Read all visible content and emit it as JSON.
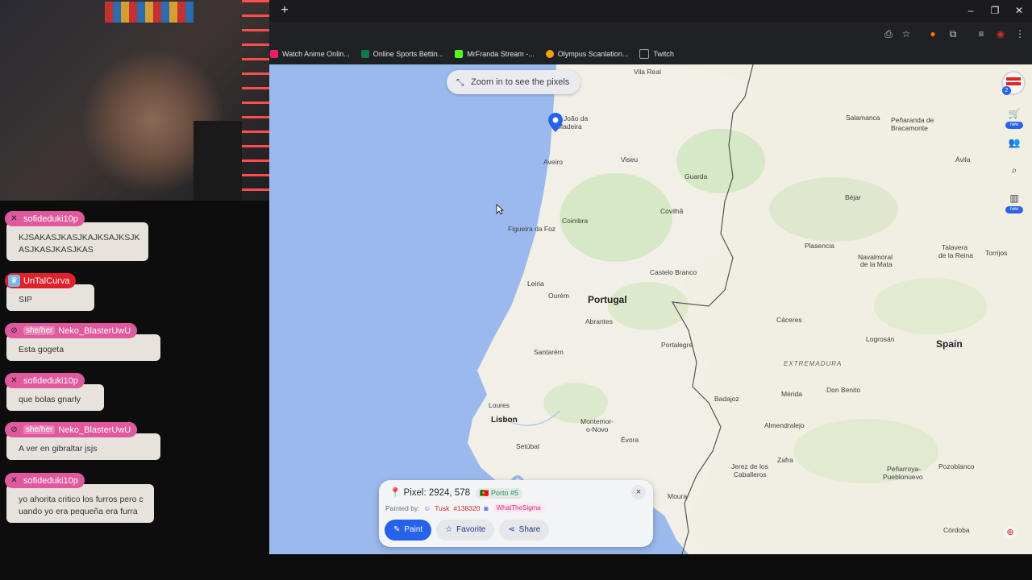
{
  "browser": {
    "bookmarks": [
      {
        "label": "Watch Anime Onlin...",
        "color": "#e91e63"
      },
      {
        "label": "Online Sports Bettin...",
        "color": "#0e7a4a"
      },
      {
        "label": "MrFranda Stream -...",
        "color": "#53fc18"
      },
      {
        "label": "Olympus Scanlation...",
        "color": "#f59e0b"
      },
      {
        "label": "Twitch",
        "color": "#9aa0a6"
      }
    ]
  },
  "map": {
    "zoom_hint": "Zoom in to see the pixels",
    "labels": {
      "vila_real": "Vila Real",
      "joao_madeira_1": "João da",
      "joao_madeira_2": "Madeira",
      "salamanca": "Salamanca",
      "penaranda_1": "Peñaranda de",
      "penaranda_2": "Bracamonte",
      "aveiro": "Aveiro",
      "viseu": "Viseu",
      "guarda": "Guarda",
      "avila": "Ávila",
      "bejar": "Béjar",
      "coimbra": "Coimbra",
      "covilha": "Covilhã",
      "figueira": "Figueira da Foz",
      "plasencia": "Plasencia",
      "navalmoral_1": "Navalmoral",
      "navalmoral_2": "de la Mata",
      "talavera_1": "Talavera",
      "talavera_2": "de la Reina",
      "torrijos": "Torrijos",
      "castelo_branco": "Castelo Branco",
      "leiria": "Leiria",
      "ourem": "Ourém",
      "portugal": "Portugal",
      "abrantes": "Abrantes",
      "caceres": "Cáceres",
      "santarem": "Santarém",
      "portalegre": "Portalegre",
      "logrosan": "Logrosán",
      "spain": "Spain",
      "extremadura": "EXTREMADURA",
      "merida": "Mérida",
      "don_benito": "Don Benito",
      "badajoz": "Badajoz",
      "loures": "Loures",
      "lisbon": "Lisbon",
      "montemor_1": "Montemor-",
      "montemor_2": "o-Novo",
      "evora": "Évora",
      "almendralejo": "Almendralejo",
      "setubal": "Setúbal",
      "zafra": "Zafra",
      "jerez_1": "Jerez de los",
      "jerez_2": "Caballeros",
      "penarroya_1": "Peñarroya-",
      "penarroya_2": "Pueblonuevo",
      "pozoblanco": "Pozoblanco",
      "moura": "Moura",
      "cordoba": "Córdoba"
    }
  },
  "sidebar_tools": {
    "new_badge_1": "new",
    "new_badge_2": "new",
    "notif_count": "2"
  },
  "pixel_panel": {
    "title": "Pixel: 2924, 578",
    "region": "Porto #5",
    "painted_by_label": "Painted by:",
    "painter": "Tusk",
    "painter_id": "#138320",
    "alliance": "WhatTheSigma",
    "paint_label": "Paint",
    "favorite_label": "Favorite",
    "share_label": "Share",
    "close_icon": "×"
  },
  "chat": {
    "messages": [
      {
        "user": "sofideduki10p",
        "color": "#e0589d",
        "pronoun": "",
        "text": "KJSAKASJKASJKAJKSAJKSJKASJKASJKASJKAS"
      },
      {
        "user": "UnTalCurva",
        "color": "#e0212c",
        "pronoun": "",
        "text": "SIP"
      },
      {
        "user": "Neko_BlasterUwU",
        "color": "#e0589d",
        "pronoun": "she/her",
        "text": "Esta gogeta"
      },
      {
        "user": "sofideduki10p",
        "color": "#e0589d",
        "pronoun": "",
        "text": "que bolas gnarly"
      },
      {
        "user": "Neko_BlasterUwU",
        "color": "#e0589d",
        "pronoun": "she/her",
        "text": "A ver en gibraltar jsjs"
      },
      {
        "user": "sofideduki10p",
        "color": "#e0589d",
        "pronoun": "",
        "text": "yo ahorita critico los furros pero cuando yo era pequeña era furra"
      }
    ]
  }
}
